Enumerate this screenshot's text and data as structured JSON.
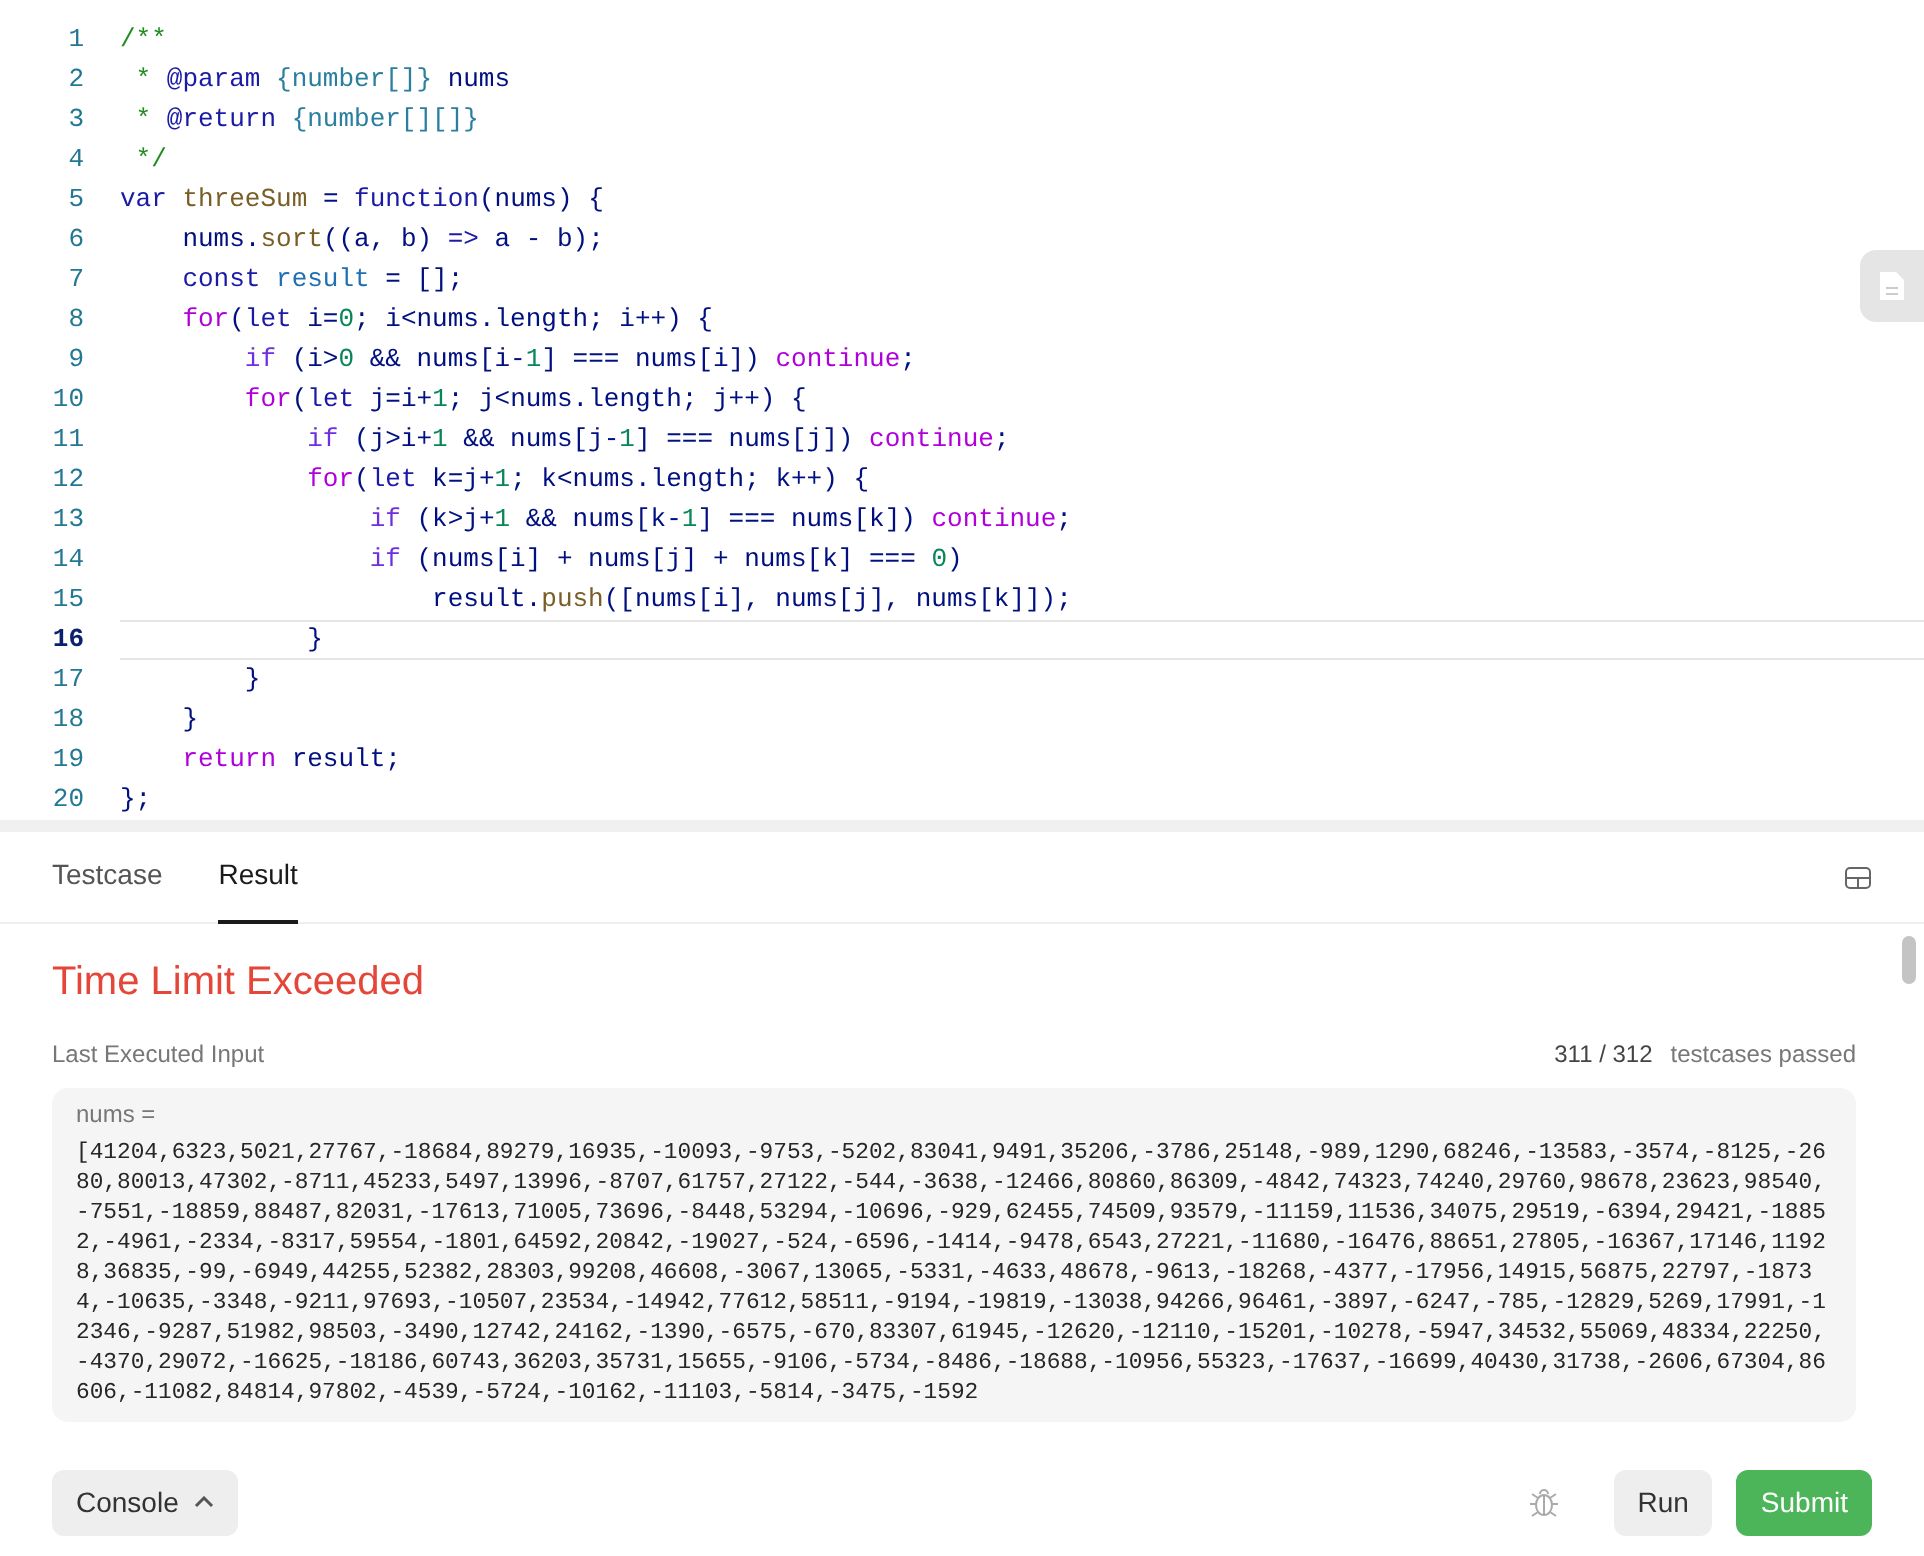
{
  "editor": {
    "lines": [
      {
        "number": "1",
        "active": false,
        "tokens": [
          {
            "kind": "comment",
            "text": "/**"
          }
        ]
      },
      {
        "number": "2",
        "active": false,
        "tokens": [
          {
            "kind": "comment",
            "text": " * "
          },
          {
            "kind": "doctag",
            "text": "@param "
          },
          {
            "kind": "doctype",
            "text": "{number[]}"
          },
          {
            "kind": "plain",
            "text": " nums"
          }
        ]
      },
      {
        "number": "3",
        "active": false,
        "tokens": [
          {
            "kind": "comment",
            "text": " * "
          },
          {
            "kind": "doctag",
            "text": "@return "
          },
          {
            "kind": "doctype",
            "text": "{number[][]}"
          }
        ]
      },
      {
        "number": "4",
        "active": false,
        "tokens": [
          {
            "kind": "comment",
            "text": " */"
          }
        ]
      },
      {
        "number": "5",
        "active": false,
        "tokens": [
          {
            "kind": "keyword",
            "text": "var "
          },
          {
            "kind": "function",
            "text": "threeSum"
          },
          {
            "kind": "plain",
            "text": " = "
          },
          {
            "kind": "keyword",
            "text": "function"
          },
          {
            "kind": "plain",
            "text": "(nums) {"
          }
        ]
      },
      {
        "number": "6",
        "active": false,
        "tokens": [
          {
            "kind": "plain",
            "text": "    nums."
          },
          {
            "kind": "function",
            "text": "sort"
          },
          {
            "kind": "plain",
            "text": "((a, b) "
          },
          {
            "kind": "keyword",
            "text": "=>"
          },
          {
            "kind": "plain",
            "text": " a - b);"
          }
        ]
      },
      {
        "number": "7",
        "active": false,
        "tokens": [
          {
            "kind": "keyword",
            "text": "    const "
          },
          {
            "kind": "def",
            "text": "result"
          },
          {
            "kind": "plain",
            "text": " = [];"
          }
        ]
      },
      {
        "number": "8",
        "active": false,
        "tokens": [
          {
            "kind": "control",
            "text": "    for"
          },
          {
            "kind": "plain",
            "text": "("
          },
          {
            "kind": "keyword",
            "text": "let"
          },
          {
            "kind": "plain",
            "text": " i="
          },
          {
            "kind": "number",
            "text": "0"
          },
          {
            "kind": "plain",
            "text": "; i<nums.length; i++) {"
          }
        ]
      },
      {
        "number": "9",
        "active": false,
        "tokens": [
          {
            "kind": "branch",
            "text": "        if"
          },
          {
            "kind": "plain",
            "text": " (i>"
          },
          {
            "kind": "number",
            "text": "0"
          },
          {
            "kind": "plain",
            "text": " && nums[i-"
          },
          {
            "kind": "number",
            "text": "1"
          },
          {
            "kind": "plain",
            "text": "] === nums[i]) "
          },
          {
            "kind": "control",
            "text": "continue"
          },
          {
            "kind": "plain",
            "text": ";"
          }
        ]
      },
      {
        "number": "10",
        "active": false,
        "tokens": [
          {
            "kind": "control",
            "text": "        for"
          },
          {
            "kind": "plain",
            "text": "("
          },
          {
            "kind": "keyword",
            "text": "let"
          },
          {
            "kind": "plain",
            "text": " j=i+"
          },
          {
            "kind": "number",
            "text": "1"
          },
          {
            "kind": "plain",
            "text": "; j<nums.length; j++) {"
          }
        ]
      },
      {
        "number": "11",
        "active": false,
        "tokens": [
          {
            "kind": "branch",
            "text": "            if"
          },
          {
            "kind": "plain",
            "text": " (j>i+"
          },
          {
            "kind": "number",
            "text": "1"
          },
          {
            "kind": "plain",
            "text": " && nums[j-"
          },
          {
            "kind": "number",
            "text": "1"
          },
          {
            "kind": "plain",
            "text": "] === nums[j]) "
          },
          {
            "kind": "control",
            "text": "continue"
          },
          {
            "kind": "plain",
            "text": ";"
          }
        ]
      },
      {
        "number": "12",
        "active": false,
        "tokens": [
          {
            "kind": "control",
            "text": "            for"
          },
          {
            "kind": "plain",
            "text": "("
          },
          {
            "kind": "keyword",
            "text": "let"
          },
          {
            "kind": "plain",
            "text": " k=j+"
          },
          {
            "kind": "number",
            "text": "1"
          },
          {
            "kind": "plain",
            "text": "; k<nums.length; k++) {"
          }
        ]
      },
      {
        "number": "13",
        "active": false,
        "tokens": [
          {
            "kind": "branch",
            "text": "                if"
          },
          {
            "kind": "plain",
            "text": " (k>j+"
          },
          {
            "kind": "number",
            "text": "1"
          },
          {
            "kind": "plain",
            "text": " && nums[k-"
          },
          {
            "kind": "number",
            "text": "1"
          },
          {
            "kind": "plain",
            "text": "] === nums[k]) "
          },
          {
            "kind": "control",
            "text": "continue"
          },
          {
            "kind": "plain",
            "text": ";"
          }
        ]
      },
      {
        "number": "14",
        "active": false,
        "tokens": [
          {
            "kind": "branch",
            "text": "                if"
          },
          {
            "kind": "plain",
            "text": " (nums[i] + nums[j] + nums[k] === "
          },
          {
            "kind": "number",
            "text": "0"
          },
          {
            "kind": "plain",
            "text": ")"
          }
        ]
      },
      {
        "number": "15",
        "active": false,
        "tokens": [
          {
            "kind": "plain",
            "text": "                    result."
          },
          {
            "kind": "function",
            "text": "push"
          },
          {
            "kind": "plain",
            "text": "([nums[i], nums[j], nums[k]]);"
          }
        ]
      },
      {
        "number": "16",
        "active": true,
        "tokens": [
          {
            "kind": "plain",
            "text": "            }"
          }
        ]
      },
      {
        "number": "17",
        "active": false,
        "tokens": [
          {
            "kind": "plain",
            "text": "        }"
          }
        ]
      },
      {
        "number": "18",
        "active": false,
        "tokens": [
          {
            "kind": "plain",
            "text": "    }"
          }
        ]
      },
      {
        "number": "19",
        "active": false,
        "tokens": [
          {
            "kind": "control",
            "text": "    return"
          },
          {
            "kind": "plain",
            "text": " result;"
          }
        ]
      },
      {
        "number": "20",
        "active": false,
        "tokens": [
          {
            "kind": "plain",
            "text": "};"
          }
        ]
      }
    ]
  },
  "tabs": [
    {
      "label": "Testcase",
      "selected": false
    },
    {
      "label": "Result",
      "selected": true
    }
  ],
  "result": {
    "status": "Time Limit Exceeded",
    "input_label": "Last Executed Input",
    "passed_count": "311 / 312",
    "passed_text": "testcases passed",
    "input": {
      "name": "nums =",
      "value": "[41204,6323,5021,27767,-18684,89279,16935,-10093,-9753,-5202,83041,9491,35206,-3786,25148,-989,1290,68246,-13583,-3574,-8125,-2680,80013,47302,-8711,45233,5497,13996,-8707,61757,27122,-544,-3638,-12466,80860,86309,-4842,74323,74240,29760,98678,23623,98540,-7551,-18859,88487,82031,-17613,71005,73696,-8448,53294,-10696,-929,62455,74509,93579,-11159,11536,34075,29519,-6394,29421,-18852,-4961,-2334,-8317,59554,-1801,64592,20842,-19027,-524,-6596,-1414,-9478,6543,27221,-11680,-16476,88651,27805,-16367,17146,11928,36835,-99,-6949,44255,52382,28303,99208,46608,-3067,13065,-5331,-4633,48678,-9613,-18268,-4377,-17956,14915,56875,22797,-18734,-10635,-3348,-9211,97693,-10507,23534,-14942,77612,58511,-9194,-19819,-13038,94266,96461,-3897,-6247,-785,-12829,5269,17991,-12346,-9287,51982,98503,-3490,12742,24162,-1390,-6575,-670,83307,61945,-12620,-12110,-15201,-10278,-5947,34532,55069,48334,22250,-4370,29072,-16625,-18186,60743,36203,35731,15655,-9106,-5734,-8486,-18688,-10956,55323,-17637,-16699,40430,31738,-2606,67304,86606,-11082,84814,97802,-4539,-5724,-10162,-11103,-5814,-3475,-1592"
    }
  },
  "footer": {
    "console": "Console",
    "run": "Run",
    "submit": "Submit"
  }
}
